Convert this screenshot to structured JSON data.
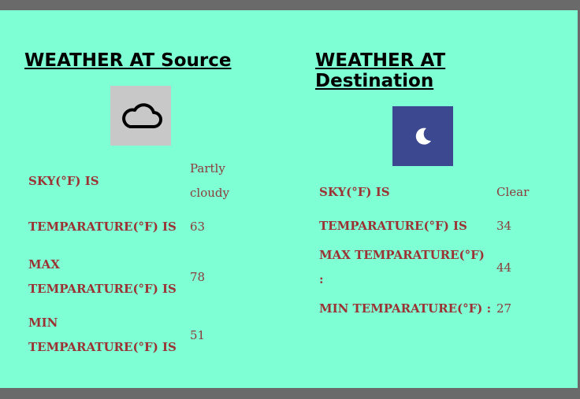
{
  "source": {
    "title": "WEATHER AT Source",
    "icon": "cloud-icon",
    "icon_bg": "#c8c8c8",
    "rows": [
      {
        "label": "SKY(°F) IS",
        "value": "Partly cloudy"
      },
      {
        "label": "TEMPARATURE(°F) IS",
        "value": "63"
      },
      {
        "label": "MAX TEMPARATURE(°F) IS",
        "value": "78"
      },
      {
        "label": "MIN TEMPARATURE(°F) IS",
        "value": "51"
      }
    ]
  },
  "destination": {
    "title": "WEATHER AT Destination",
    "icon": "moon-icon",
    "icon_bg": "#3c4990",
    "rows": [
      {
        "label": "SKY(°F) IS",
        "value": "Clear"
      },
      {
        "label": "TEMPARATURE(°F) IS",
        "value": "34"
      },
      {
        "label": "MAX TEMPARATURE(°F) :",
        "value": "44"
      },
      {
        "label": "MIN TEMPARATURE(°F) :",
        "value": "27"
      }
    ]
  },
  "colors": {
    "panel_bg": "#7fffd4",
    "frame": "#6a6a6a",
    "label_text": "#9b3334"
  }
}
